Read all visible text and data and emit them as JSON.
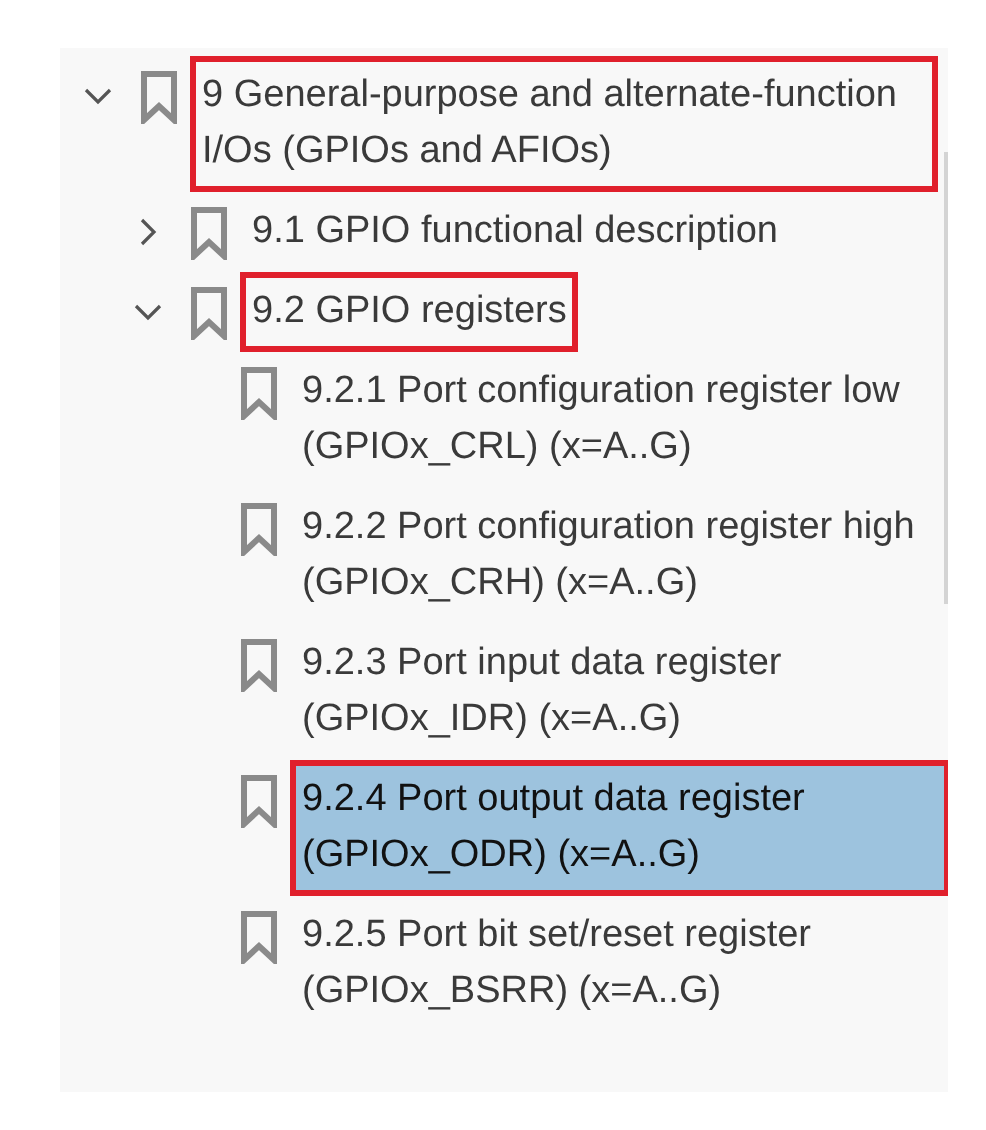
{
  "bookmarks": [
    {
      "label": "9 General-purpose and alternate-function I/Os (GPIOs and AFIOs)",
      "expanded": true,
      "selected": false,
      "annotated": true,
      "children": [
        {
          "label": "9.1 GPIO functional description",
          "expanded": false,
          "selected": false,
          "annotated": false
        },
        {
          "label": "9.2 GPIO registers",
          "expanded": true,
          "selected": false,
          "annotated": true,
          "children": [
            {
              "label": "9.2.1 Port configuration register low (GPIOx_CRL) (x=A..G)",
              "selected": false,
              "annotated": false
            },
            {
              "label": "9.2.2 Port configuration register high (GPIOx_CRH) (x=A..G)",
              "selected": false,
              "annotated": false
            },
            {
              "label": "9.2.3 Port input data register (GPIOx_IDR) (x=A..G)",
              "selected": false,
              "annotated": false
            },
            {
              "label": "9.2.4 Port output data register (GPIOx_ODR) (x=A..G)",
              "selected": true,
              "annotated": true
            },
            {
              "label": "9.2.5 Port bit set/reset register (GPIOx_BSRR) (x=A..G)",
              "selected": false,
              "annotated": false
            }
          ]
        }
      ]
    }
  ]
}
